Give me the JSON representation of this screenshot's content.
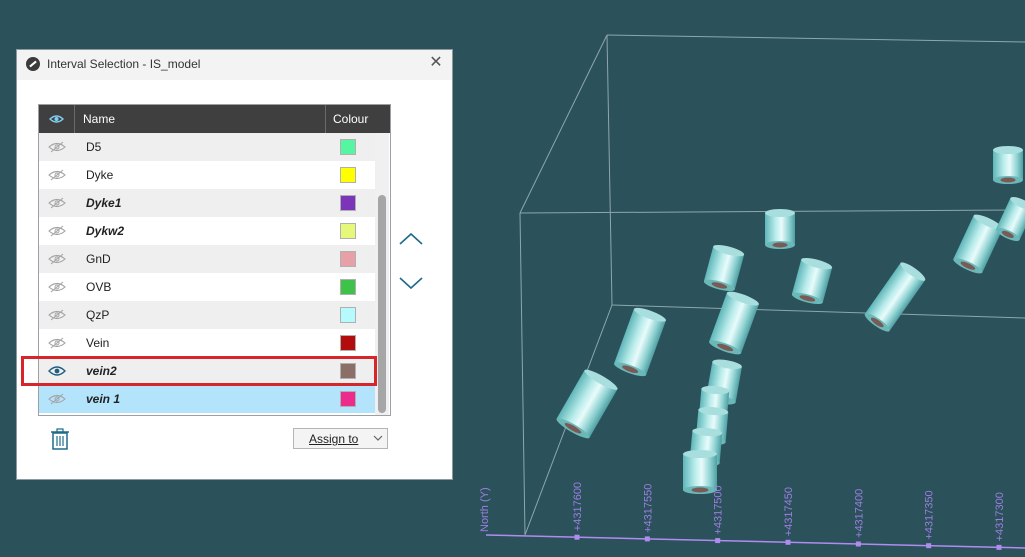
{
  "window": {
    "title": "Interval Selection - IS_model",
    "close_glyph": "✕"
  },
  "table": {
    "columns": {
      "name": "Name",
      "colour": "Colour"
    },
    "rows": [
      {
        "name": "D5",
        "visible": false,
        "bold": false,
        "selected": false,
        "color": "#55f5a2"
      },
      {
        "name": "Dyke",
        "visible": false,
        "bold": false,
        "selected": false,
        "color": "#ffff00"
      },
      {
        "name": "Dyke1",
        "visible": false,
        "bold": true,
        "selected": false,
        "color": "#7a35b8"
      },
      {
        "name": "Dykw2",
        "visible": false,
        "bold": true,
        "selected": false,
        "color": "#e6f77a"
      },
      {
        "name": "GnD",
        "visible": false,
        "bold": false,
        "selected": false,
        "color": "#e8a0a8"
      },
      {
        "name": "OVB",
        "visible": false,
        "bold": false,
        "selected": false,
        "color": "#3ec24a"
      },
      {
        "name": "QzP",
        "visible": false,
        "bold": false,
        "selected": false,
        "color": "#b5fafd"
      },
      {
        "name": "Vein",
        "visible": false,
        "bold": false,
        "selected": false,
        "color": "#b20c0c"
      },
      {
        "name": "vein2",
        "visible": true,
        "bold": true,
        "selected": false,
        "color": "#8b6e66"
      },
      {
        "name": "vein 1",
        "visible": false,
        "bold": true,
        "selected": true,
        "color": "#ec2c8c"
      }
    ]
  },
  "buttons": {
    "move_up": "move-up-icon",
    "move_down": "move-down-icon",
    "delete": "trash-icon",
    "assign_label": "Assign to"
  },
  "viewport": {
    "axis_title": "North (Y)",
    "ticks": [
      "+4317600",
      "+4317550",
      "+4317500",
      "+4317450",
      "+4317400",
      "+4317350",
      "+4317300"
    ]
  },
  "colors": {
    "background": "#2b515b",
    "header": "#3f3f3f",
    "selected_row": "#b3e4fb",
    "alt_row": "#efefef",
    "highlight": "#d7252c",
    "accent": "#1f6a8a",
    "axis": "#9c7fe0"
  }
}
